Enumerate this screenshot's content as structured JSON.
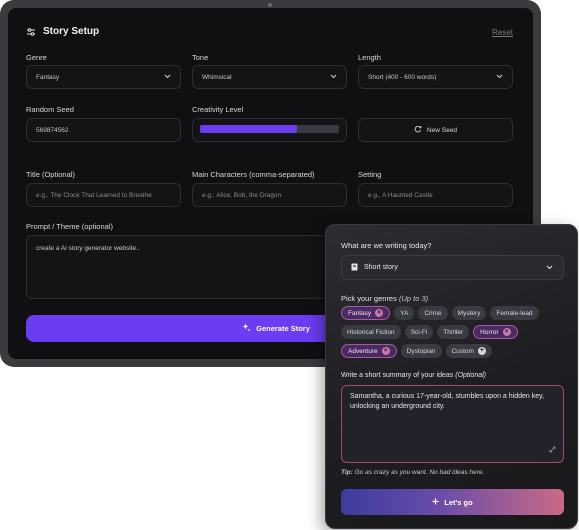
{
  "setup": {
    "title": "Story Setup",
    "title_icon": "sliders-icon",
    "reset_label": "Reset",
    "genre": {
      "label": "Genre",
      "value": "Fantasy"
    },
    "tone": {
      "label": "Tone",
      "value": "Whimsical"
    },
    "length": {
      "label": "Length",
      "value": "Short (400 - 600 words)"
    },
    "seed": {
      "label": "Random Seed",
      "value": "569874562"
    },
    "creativity": {
      "label": "Creativity Level",
      "level": 0.7,
      "color": "#6a3df0"
    },
    "new_seed_label": "New Seed",
    "title_field": {
      "label": "Title (Optional)",
      "placeholder": "e.g., The Clock That Learned to Breathe"
    },
    "characters": {
      "label": "Main Characters (comma-separated)",
      "placeholder": "e.g., Alice, Bob, the Dragon"
    },
    "setting": {
      "label": "Setting",
      "placeholder": "e.g., A Haunted Castle"
    },
    "prompt": {
      "label": "Prompt / Theme (optional)",
      "value": "create a Ai story generator website.."
    },
    "generate_label": "Generate Story"
  },
  "wizard": {
    "question": "What are we writing today?",
    "type_value": "Short story",
    "genres_label": "Pick your genres",
    "genres_hint": "(Up to 3)",
    "genre_rows": [
      [
        {
          "label": "Fantasy",
          "selected": true
        },
        {
          "label": "YA",
          "selected": false
        },
        {
          "label": "Crime",
          "selected": false
        },
        {
          "label": "Mystery",
          "selected": false
        },
        {
          "label": "Female-lead",
          "selected": false
        }
      ],
      [
        {
          "label": "Historical Fiction",
          "selected": false
        },
        {
          "label": "Sci-Fi",
          "selected": false
        },
        {
          "label": "Thriller",
          "selected": false
        },
        {
          "label": "Horror",
          "selected": true
        }
      ],
      [
        {
          "label": "Adventure",
          "selected": true
        },
        {
          "label": "Dystopian",
          "selected": false
        },
        {
          "label": "Custom",
          "selected": false,
          "add": true
        }
      ]
    ],
    "summary_label": "Write a short summary of your ideas",
    "summary_hint": "(Optional)",
    "summary_value": "Samantha, a curious 17-year-old, stumbles upon a hidden key, unlocking an underground city.",
    "tip_label": "Tip:",
    "tip_text": "Go as crazy as you want. No bad ideas here.",
    "go_label": "Let's go",
    "accent": "#c96a86"
  }
}
